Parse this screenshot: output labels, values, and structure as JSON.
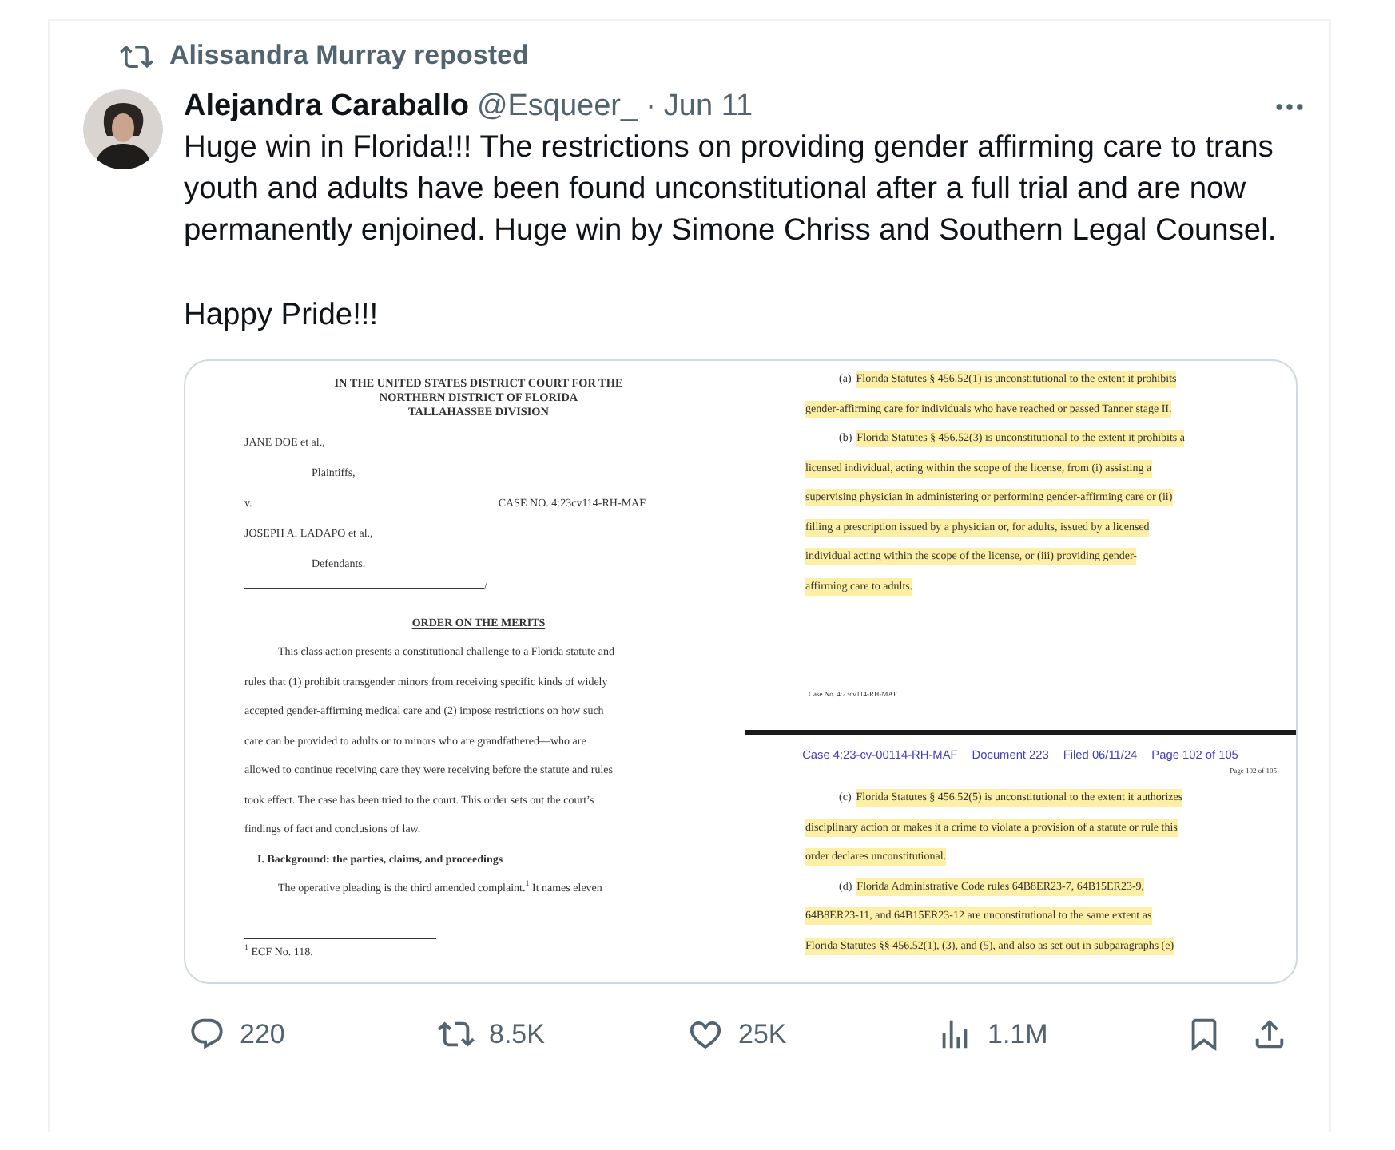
{
  "repost_banner": {
    "text": "Alissandra Murray reposted"
  },
  "tweet": {
    "author_name": "Alejandra Caraballo",
    "handle": "@Esqueer_",
    "separator": "·",
    "date": "Jun 11",
    "paragraphs": [
      "Huge win in Florida!!! The restrictions on providing gender affirming care to trans youth and adults have been found unconstitutional after a full trial and are now permanently enjoined. Huge win by Simone Chriss and Southern Legal Counsel.",
      "Happy Pride!!!"
    ],
    "document": {
      "left_page": {
        "lines": [
          {
            "kind": "title",
            "text": "IN THE UNITED STATES DISTRICT COURT FOR THE"
          },
          {
            "kind": "title",
            "text": "NORTHERN DISTRICT OF FLORIDA"
          },
          {
            "kind": "title",
            "text": "TALLAHASSEE DIVISION"
          },
          {
            "kind": "party",
            "text": "JANE DOE et al.,"
          },
          {
            "kind": "role",
            "text": "Plaintiffs,"
          },
          {
            "kind": "split",
            "text": "v.",
            "right": "CASE NO. 4:23cv114-RH-MAF"
          },
          {
            "kind": "party",
            "text": "JOSEPH A. LADAPO et al.,"
          },
          {
            "kind": "role",
            "text": "Defendants."
          },
          {
            "kind": "signature",
            "text": "/"
          },
          {
            "kind": "heading",
            "text": "ORDER ON THE MERITS"
          },
          {
            "kind": "para",
            "text": "This class action presents a constitutional challenge to a Florida statute and"
          },
          {
            "kind": "body",
            "text": "rules that (1) prohibit transgender minors from receiving specific kinds of widely"
          },
          {
            "kind": "body",
            "text": "accepted gender-affirming medical care and (2) impose restrictions on how such"
          },
          {
            "kind": "body",
            "text": "care can be provided to adults or to minors who are grandfathered—who are"
          },
          {
            "kind": "body",
            "text": "allowed to continue receiving care they were receiving before the statute and rules"
          },
          {
            "kind": "body",
            "text": "took effect. The case has been tried to the court. This order sets out the court’s"
          },
          {
            "kind": "body",
            "text": "findings of fact and conclusions of law."
          },
          {
            "kind": "section",
            "text": "I. Background: the parties, claims, and proceedings"
          },
          {
            "kind": "para",
            "text": "The operative pleading is the third amended complaint.$^{1}$ It names eleven"
          },
          {
            "kind": "footnote",
            "text": "$^{1}$ ECF No. 118."
          }
        ]
      },
      "right_page": {
        "top_lines": [
          {
            "kind": "para",
            "marker": "(a)",
            "text": "Florida Statutes § 456.52(1) is unconstitutional to the extent it prohibits",
            "highlighted": true
          },
          {
            "kind": "body",
            "text": "gender-affirming care for individuals who have reached or passed Tanner stage II.",
            "highlighted": true
          },
          {
            "kind": "para",
            "marker": "(b)",
            "text": "Florida Statutes § 456.52(3) is unconstitutional to the extent it prohibits a",
            "highlighted": true
          },
          {
            "kind": "body",
            "text": "licensed individual, acting within the scope of the license, from (i) assisting a",
            "highlighted": true
          },
          {
            "kind": "body",
            "text": "supervising physician in administering or performing gender-affirming care or (ii)",
            "highlighted": true
          },
          {
            "kind": "body",
            "text": "filling a prescription issued by a physician or, for adults, issued by a licensed",
            "highlighted": true
          },
          {
            "kind": "body",
            "text": "individual acting within the scope of the license, or (iii) providing gender-",
            "highlighted": true
          },
          {
            "kind": "body",
            "text": "affirming care to adults.",
            "highlighted": true
          }
        ],
        "footer": "Case No. 4:23cv114-RH-MAF",
        "header": [
          "Case 4:23-cv-00114-RH-MAF",
          "Document 223",
          "Filed 06/11/24",
          "Page 102 of 105"
        ],
        "page_label": "Page 102 of 105",
        "bottom_lines": [
          {
            "kind": "para",
            "marker": "(c)",
            "text": "Florida Statutes § 456.52(5) is unconstitutional to the extent it authorizes",
            "highlighted": true
          },
          {
            "kind": "body",
            "text": "disciplinary action or makes it a crime to violate a provision of a statute or rule this",
            "highlighted": true
          },
          {
            "kind": "body",
            "text": "order declares unconstitutional.",
            "highlighted": true
          },
          {
            "kind": "para",
            "marker": "(d)",
            "text": "Florida Administrative Code rules 64B8ER23-7, 64B15ER23-9,",
            "highlighted": true
          },
          {
            "kind": "body",
            "text": "64B8ER23-11, and 64B15ER23-12 are unconstitutional to the same extent as",
            "highlighted": true
          },
          {
            "kind": "body",
            "text": "Florida Statutes §§ 456.52(1), (3), and (5), and also as set out in subparagraphs (e)",
            "highlighted": true
          }
        ]
      }
    },
    "actions": [
      {
        "kind": "reply",
        "count": "220"
      },
      {
        "kind": "repost",
        "count": "8.5K"
      },
      {
        "kind": "like",
        "count": "25K"
      },
      {
        "kind": "views",
        "count": "1.1M"
      }
    ],
    "tools": [
      {
        "kind": "bookmark"
      },
      {
        "kind": "share"
      }
    ]
  }
}
